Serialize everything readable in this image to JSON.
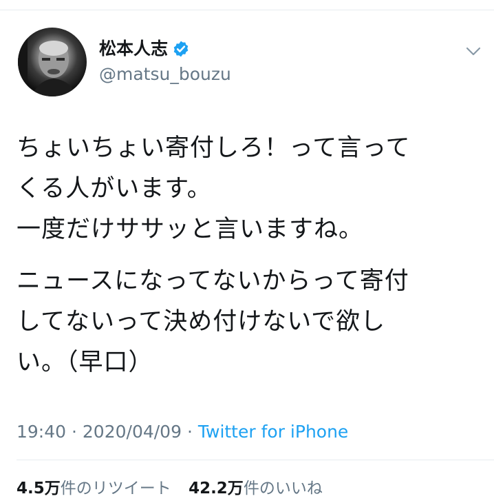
{
  "tweet": {
    "author": {
      "display_name": "松本人志",
      "handle": "@matsu_bouzu",
      "verified_icon": "verified-badge-icon",
      "avatar_icon": "avatar-photo"
    },
    "menu_icon": "chevron-down-icon",
    "paragraphs": [
      "ちょいちょい寄付しろ！って言って\nくる人がいます。\n一度だけササッと言いますね。",
      "ニュースになってないからって寄付\nしてないって決め付けないで欲し\nい。（早口）"
    ],
    "time": "19:40",
    "date": "2020/04/09",
    "separator": "·",
    "source": "Twitter for iPhone"
  },
  "stats": {
    "retweets_count": "4.5万",
    "retweets_label": "件のリツイート",
    "likes_count": "42.2万",
    "likes_label": "件のいいね"
  },
  "colors": {
    "link": "#1da1f2",
    "secondary_text": "#657786",
    "primary_text": "#14171a",
    "divider": "#e6ecf0"
  }
}
